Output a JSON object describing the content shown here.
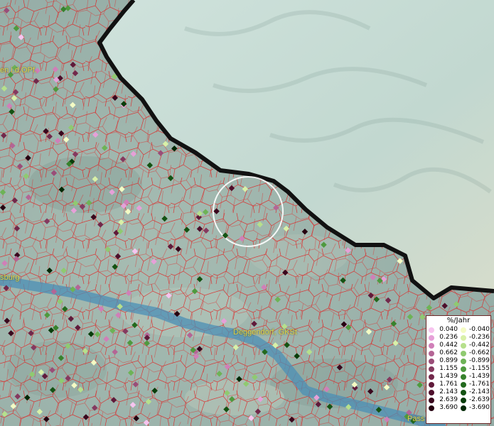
{
  "places": [
    {
      "name": "en i.d.OPf."
    },
    {
      "name": "sburg"
    },
    {
      "name": "Deggendorf, GKSt"
    },
    {
      "name": "Pass"
    }
  ],
  "legend": {
    "title": "%/Jahr",
    "positive": [
      {
        "value": "0.040",
        "color": "#f7c4ef"
      },
      {
        "value": "0.236",
        "color": "#e6a0d8"
      },
      {
        "value": "0.442",
        "color": "#d07fb8"
      },
      {
        "value": "0.662",
        "color": "#b46595"
      },
      {
        "value": "0.899",
        "color": "#9a4d78"
      },
      {
        "value": "1.155",
        "color": "#85395f"
      },
      {
        "value": "1.439",
        "color": "#72284b"
      },
      {
        "value": "1.761",
        "color": "#601a3a"
      },
      {
        "value": "2.143",
        "color": "#4e0f2b"
      },
      {
        "value": "2.639",
        "color": "#3a071d"
      },
      {
        "value": "3.690",
        "color": "#250010"
      }
    ],
    "negative": [
      {
        "value": "-0.040",
        "color": "#f4fbc4"
      },
      {
        "value": "-0.236",
        "color": "#d8f0a8"
      },
      {
        "value": "-0.442",
        "color": "#b6e08c"
      },
      {
        "value": "-0.662",
        "color": "#8fca70"
      },
      {
        "value": "-0.899",
        "color": "#6db356"
      },
      {
        "value": "-1.155",
        "color": "#4e9a3e"
      },
      {
        "value": "-1.439",
        "color": "#37822c"
      },
      {
        "value": "-1.761",
        "color": "#236a1e"
      },
      {
        "value": "-2.143",
        "color": "#145313"
      },
      {
        "value": "-2.639",
        "color": "#083d0a"
      },
      {
        "value": "-3.690",
        "color": "#012804"
      }
    ]
  },
  "colors": {
    "terrain": "#9db3ad",
    "border_region": "#c9ddd6",
    "river": "#4b8fb6",
    "boundary_lines": "#e02020",
    "national_border": "#000000",
    "place_label": "#e0d24a",
    "selection_circle": "#ffffff"
  }
}
